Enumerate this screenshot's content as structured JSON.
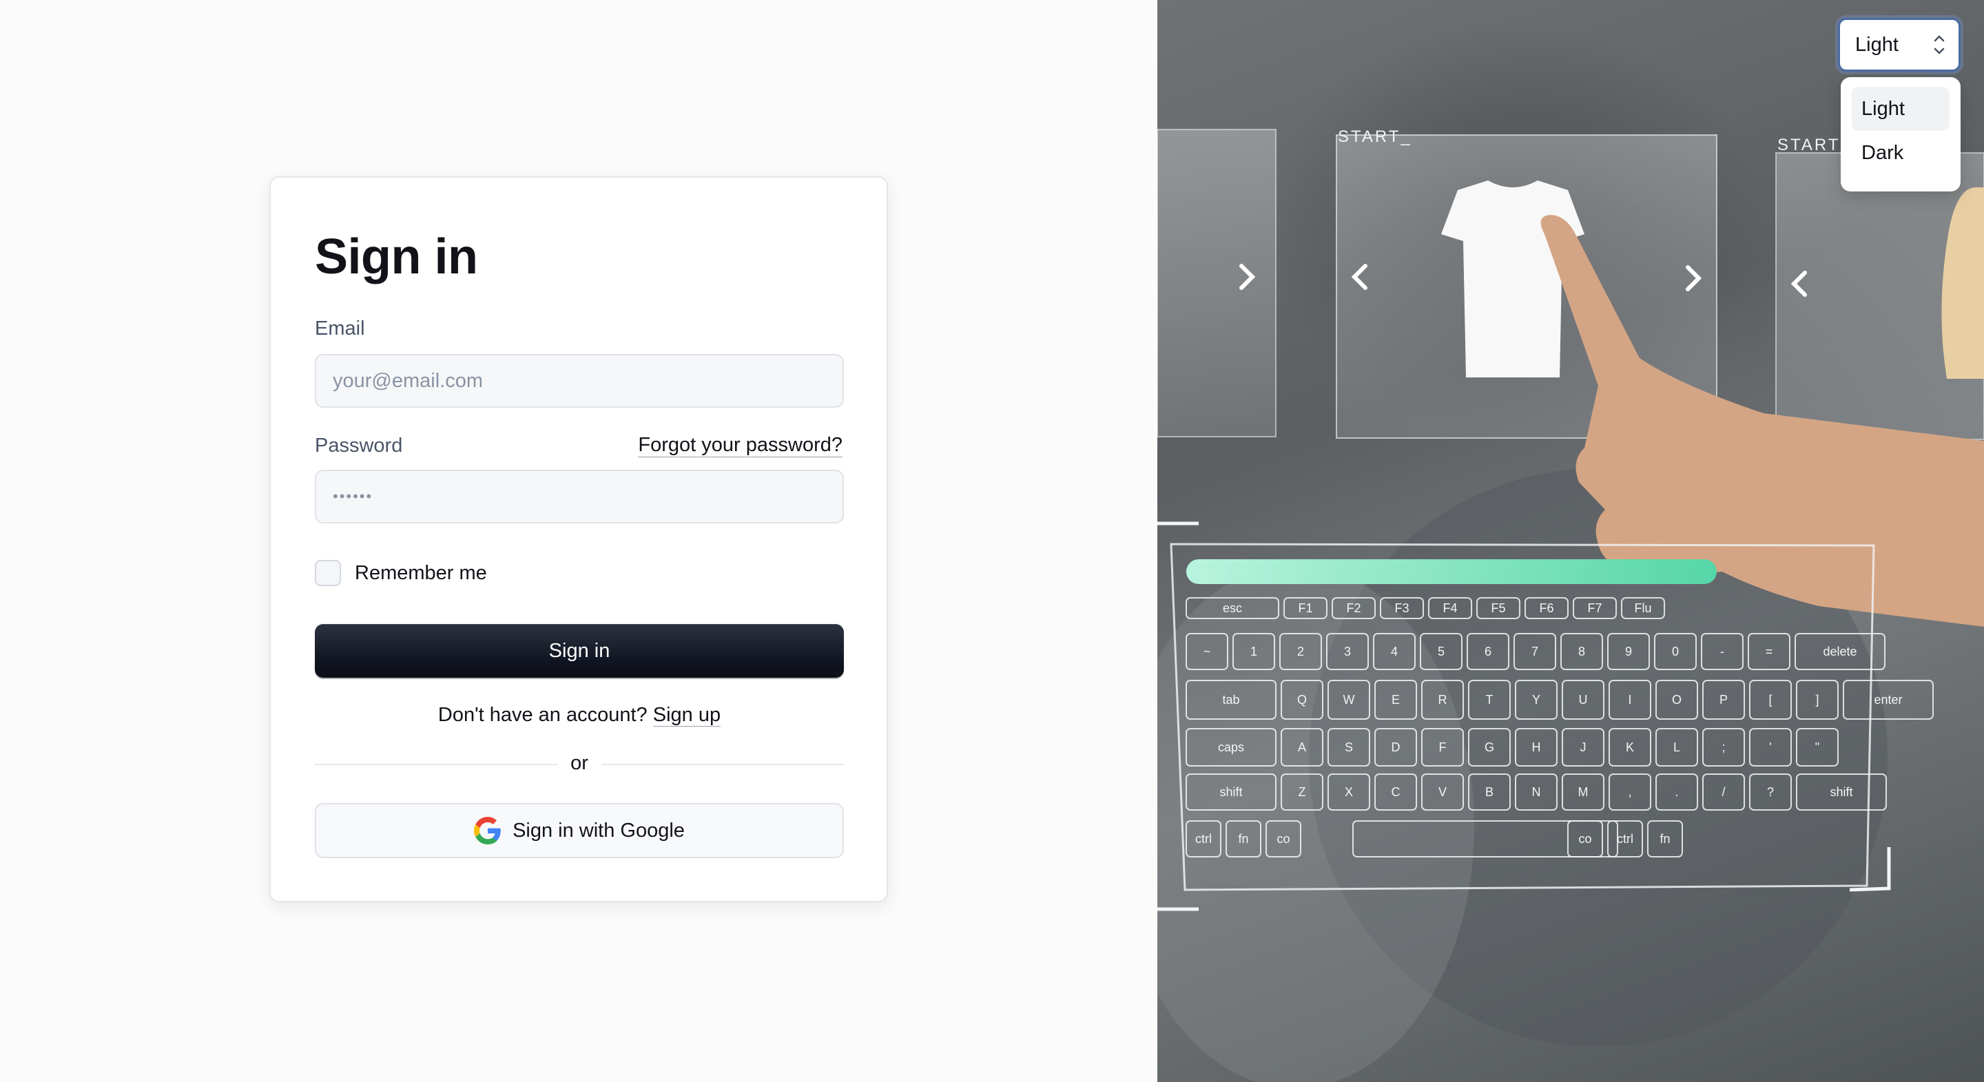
{
  "signin": {
    "title": "Sign in",
    "email_label": "Email",
    "email_placeholder": "your@email.com",
    "password_label": "Password",
    "forgot_link": "Forgot your password?",
    "password_placeholder": "••••••",
    "remember_label": "Remember me",
    "submit_label": "Sign in",
    "no_account_text": "Don't have an account?",
    "signup_link": "Sign up",
    "divider_text": "or",
    "google_button": "Sign in with Google"
  },
  "theme_select": {
    "selected": "Light",
    "options": [
      "Light",
      "Dark"
    ]
  },
  "hero": {
    "panel_caption": "START_",
    "keyboard_rows": [
      [
        "esc",
        "F1",
        "F2",
        "F3",
        "F4",
        "F5",
        "F6",
        "F7",
        "Flu"
      ],
      [
        "~",
        "1",
        "2",
        "3",
        "4",
        "5",
        "6",
        "7",
        "8",
        "9",
        "0",
        "-",
        "=",
        "delete"
      ],
      [
        "tab",
        "Q",
        "W",
        "E",
        "R",
        "T",
        "Y",
        "U",
        "I",
        "O",
        "P",
        "[",
        "]",
        "enter"
      ],
      [
        "caps",
        "A",
        "S",
        "D",
        "F",
        "G",
        "H",
        "J",
        "K",
        "L",
        ";",
        "'",
        "\""
      ],
      [
        "shift",
        "Z",
        "X",
        "C",
        "V",
        "B",
        "N",
        "M",
        ",",
        ".",
        "/",
        "?",
        "shift"
      ],
      [
        "ctrl",
        "fn",
        "co",
        "co",
        "ctrl",
        "fn"
      ]
    ]
  },
  "colors": {
    "primary_button": "#111521",
    "accent_focus": "#4a6ca3",
    "keyboard_glow": "#7be3c4"
  }
}
